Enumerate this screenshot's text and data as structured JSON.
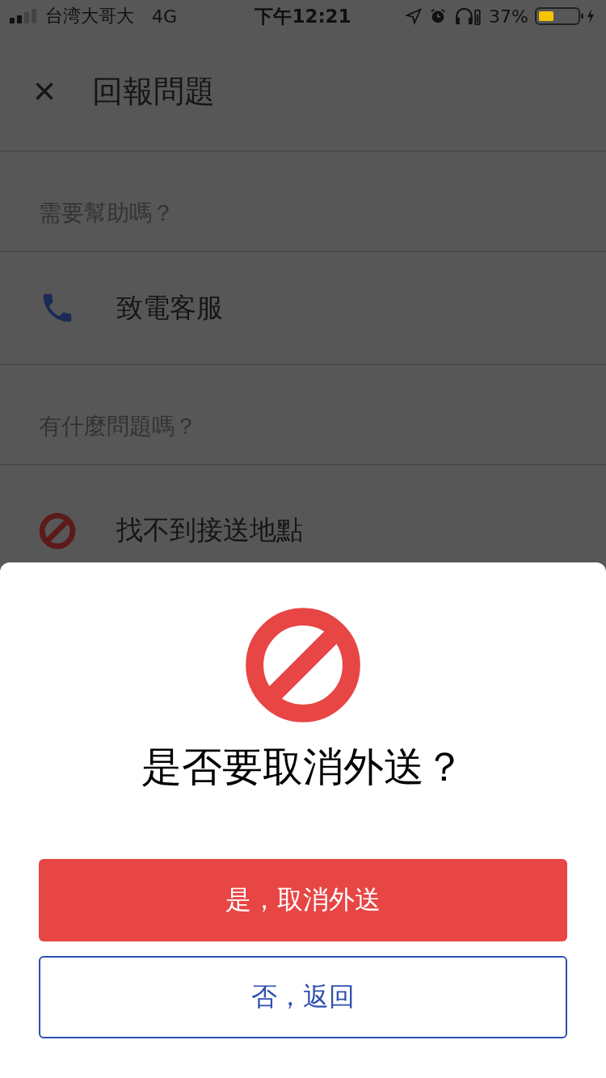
{
  "status_bar": {
    "carrier": "台湾大哥大",
    "network": "4G",
    "time": "下午12:21",
    "battery": "37%"
  },
  "header": {
    "close": "×",
    "title": "回報問題"
  },
  "sections": [
    {
      "heading": "需要幫助嗎？",
      "rows": [
        {
          "kind": "phone",
          "label": "致電客服"
        }
      ]
    },
    {
      "heading": "有什麼問題嗎？",
      "rows": [
        {
          "kind": "blocked",
          "label": "找不到接送地點"
        }
      ]
    }
  ],
  "dialog": {
    "kind": "blocked",
    "title": "是否要取消外送？",
    "buttons": [
      {
        "kind": "primary",
        "label": "是，取消外送"
      },
      {
        "kind": "secondary",
        "label": "否，返回"
      }
    ]
  }
}
